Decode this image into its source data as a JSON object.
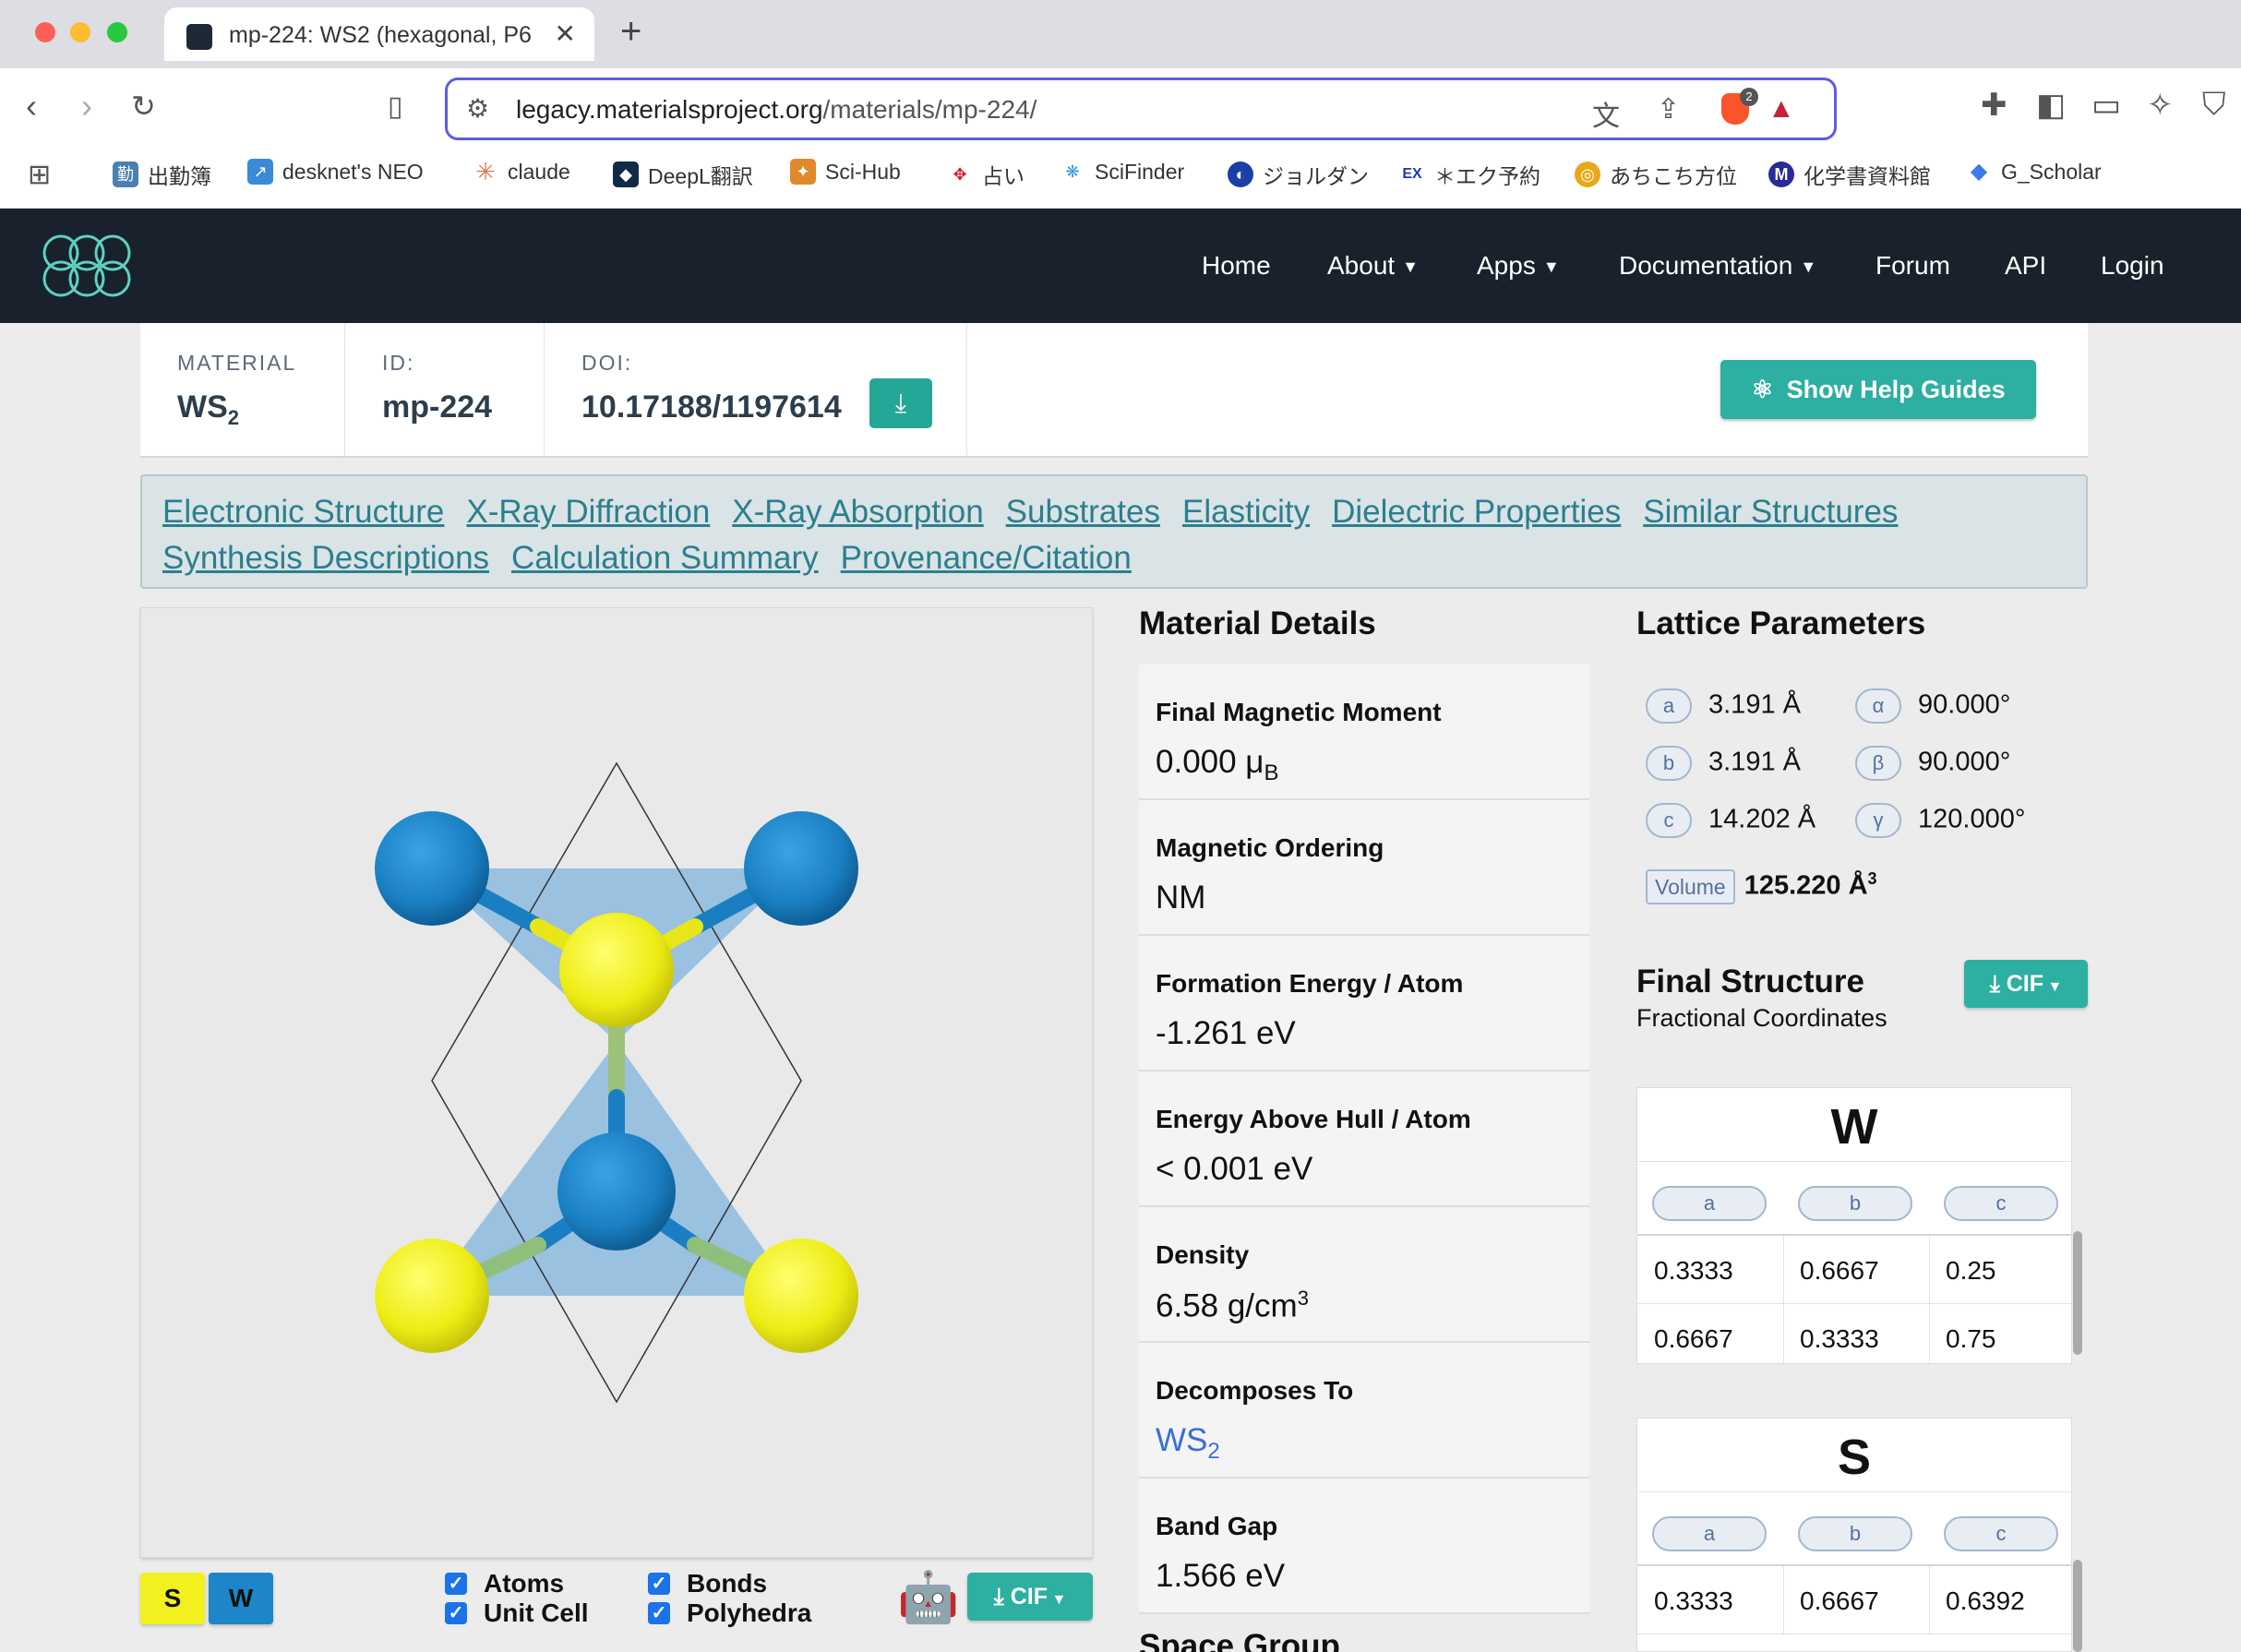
{
  "browser": {
    "tab_title": "mp-224: WS2 (hexagonal, P6",
    "url_host": "legacy.materialsproject.org",
    "url_path": "/materials/mp-224/",
    "brave_badge": "2",
    "bookmarks": [
      "出勤簿",
      "desknet's NEO",
      "claude",
      "DeepL翻訳",
      "Sci-Hub",
      "占い",
      "SciFinder",
      "ジョルダン",
      "＊エク予約",
      "あちこち方位",
      "化学書資料館",
      "G_Scholar"
    ]
  },
  "nav": {
    "items": [
      "Home",
      "About",
      "Apps",
      "Documentation",
      "Forum",
      "API",
      "Login"
    ]
  },
  "material": {
    "material_label": "MATERIAL",
    "formula_base": "WS",
    "formula_sub": "2",
    "id_label": "ID:",
    "id": "mp-224",
    "doi_label": "DOI:",
    "doi": "10.17188/1197614",
    "help_button": "Show Help Guides"
  },
  "section_links": [
    "Electronic Structure",
    "X-Ray Diffraction",
    "X-Ray Absorption",
    "Substrates",
    "Elasticity",
    "Dielectric Properties",
    "Similar Structures",
    "Synthesis Descriptions",
    "Calculation Summary",
    "Provenance/Citation"
  ],
  "viewer": {
    "elements": [
      "S",
      "W"
    ],
    "element_colors": {
      "S": "#f2f01e",
      "W": "#1c86c9"
    },
    "checkboxes": [
      {
        "label": "Atoms",
        "checked": true
      },
      {
        "label": "Unit Cell",
        "checked": true
      },
      {
        "label": "Bonds",
        "checked": true
      },
      {
        "label": "Polyhedra",
        "checked": true
      }
    ],
    "cif_label": "CIF"
  },
  "details": {
    "title": "Material Details",
    "items": [
      {
        "label": "Final Magnetic Moment",
        "value": "0.000 μ",
        "value_sub": "B"
      },
      {
        "label": "Magnetic Ordering",
        "value": "NM"
      },
      {
        "label": "Formation Energy / Atom",
        "value": "-1.261 eV"
      },
      {
        "label": "Energy Above Hull / Atom",
        "value": "< 0.001 eV"
      },
      {
        "label": "Density",
        "value": "6.58 g/cm",
        "value_sup": "3"
      },
      {
        "label": "Decomposes To",
        "value": "WS",
        "value_sub": "2"
      },
      {
        "label": "Band Gap",
        "value": "1.566 eV"
      }
    ],
    "next_section": "Space Group"
  },
  "lattice": {
    "title": "Lattice Parameters",
    "params": [
      {
        "name": "a",
        "value": "3.191 Å"
      },
      {
        "name": "b",
        "value": "3.191 Å"
      },
      {
        "name": "c",
        "value": "14.202 Å"
      },
      {
        "name": "α",
        "value": "90.000°"
      },
      {
        "name": "β",
        "value": "90.000°"
      },
      {
        "name": "γ",
        "value": "120.000°"
      }
    ],
    "volume_label": "Volume",
    "volume_value": "125.220 Å",
    "volume_sup": "3"
  },
  "structure": {
    "title": "Final Structure",
    "subtitle": "Fractional Coordinates",
    "cif_label": "CIF",
    "columns": [
      "a",
      "b",
      "c"
    ],
    "sites": [
      {
        "element": "W",
        "rows": [
          [
            "0.3333",
            "0.6667",
            "0.25"
          ],
          [
            "0.6667",
            "0.3333",
            "0.75"
          ]
        ]
      },
      {
        "element": "S",
        "rows": [
          [
            "0.3333",
            "0.6667",
            "0.6392"
          ]
        ]
      }
    ]
  }
}
